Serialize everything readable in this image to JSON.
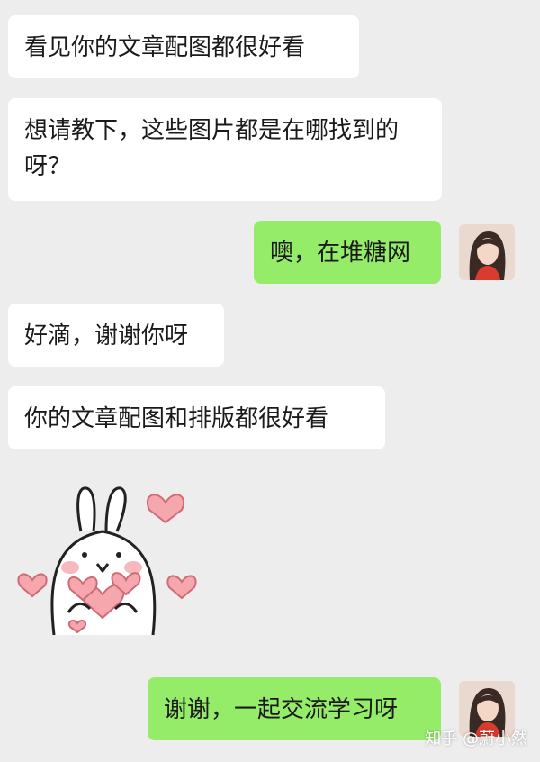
{
  "messages": [
    {
      "side": "in",
      "text": "看见你的文章配图都很好看"
    },
    {
      "side": "in",
      "text": "想请教下，这些图片都是在哪找到的呀？"
    },
    {
      "side": "out",
      "text": "噢，在堆糖网"
    },
    {
      "side": "in",
      "text": "好滴，谢谢你呀"
    },
    {
      "side": "in",
      "text": "你的文章配图和排版都很好看"
    },
    {
      "side": "in",
      "type": "sticker",
      "icon": "bunny-hearts-sticker"
    },
    {
      "side": "out",
      "text": "谢谢，一起交流学习呀"
    }
  ],
  "watermark": "知乎 @蔚小然",
  "colors": {
    "background": "#ededed",
    "incoming": "#ffffff",
    "outgoing": "#95ec69",
    "heart": "#f4a1a8"
  }
}
